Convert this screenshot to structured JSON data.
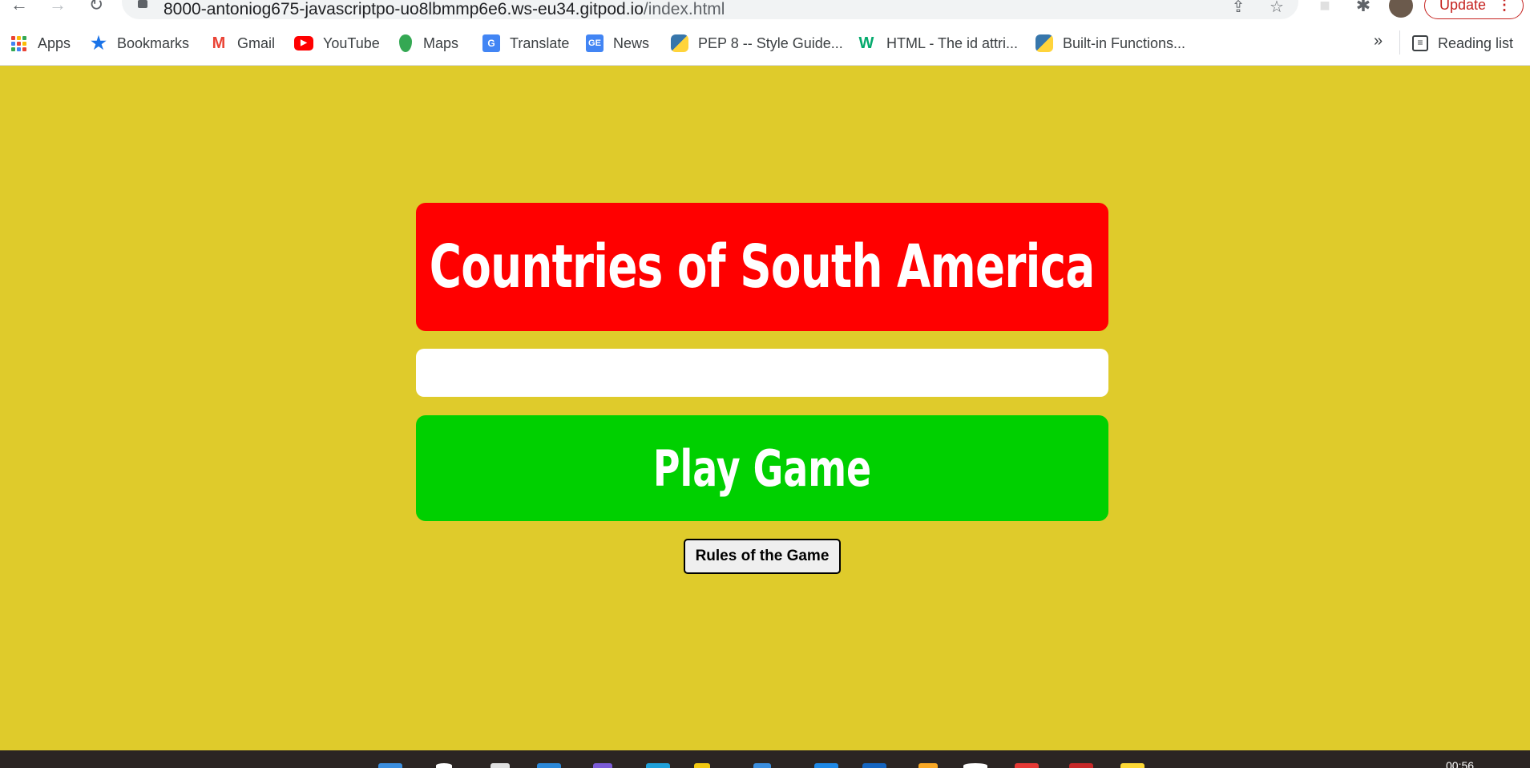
{
  "browser": {
    "url_host": "8000-antoniog675-javascriptpo-uo8lbmmp6e6.ws-eu34.gitpod.io",
    "url_path": "/index.html",
    "update_label": "Update",
    "update_menu": "⋮",
    "back_icon": "arrow-left-icon",
    "forward_icon": "arrow-right-icon",
    "reload_icon": "reload-icon",
    "more_bookmarks_label": "»"
  },
  "bookmarks": [
    {
      "label": "Apps",
      "icon": "apps-grid-icon"
    },
    {
      "label": "Bookmarks",
      "icon": "star-icon",
      "color": "#1a73e8"
    },
    {
      "label": "Gmail",
      "icon": "gmail-icon",
      "color": "#ea4335"
    },
    {
      "label": "YouTube",
      "icon": "youtube-icon",
      "color": "#ff0000"
    },
    {
      "label": "Maps",
      "icon": "maps-pin-icon",
      "color": "#34a853"
    },
    {
      "label": "Translate",
      "icon": "translate-icon",
      "color": "#4285f4"
    },
    {
      "label": "News",
      "icon": "news-icon",
      "color": "#4285f4"
    },
    {
      "label": "PEP 8 -- Style Guide...",
      "icon": "python-icon",
      "color": "#3776ab"
    },
    {
      "label": "HTML - The id attri...",
      "icon": "w3schools-icon",
      "color": "#04aa6d"
    },
    {
      "label": "Built-in Functions...",
      "icon": "python-icon",
      "color": "#3776ab"
    }
  ],
  "reading_list": {
    "label": "Reading list",
    "icon": "reading-list-icon"
  },
  "game": {
    "title": "Countries of South America",
    "answer_value": "",
    "play_label": "Play Game",
    "rules_label": "Rules of the Game"
  },
  "colors": {
    "page_background": "#dfcb2b",
    "title_background": "#ff0000",
    "play_background": "#00d000"
  },
  "taskbar": {
    "clock": "00:56"
  }
}
